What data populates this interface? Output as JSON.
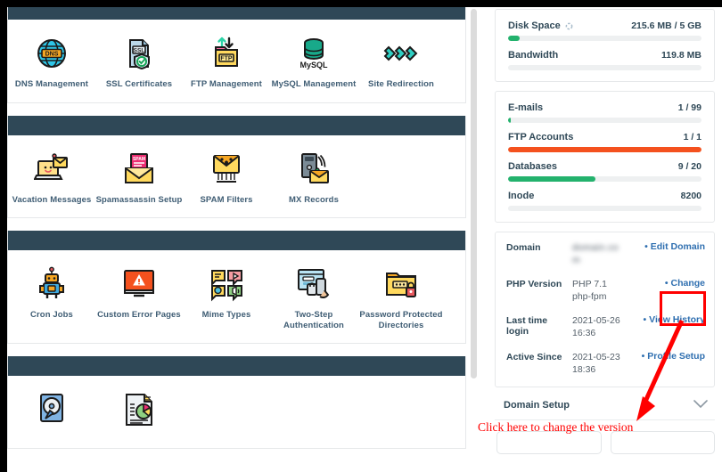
{
  "left_panel": {
    "groups": [
      {
        "group_name": "domains-group",
        "tiles": [
          {
            "icon": "dns-globe-icon",
            "label": "DNS Management"
          },
          {
            "icon": "ssl-certificate-icon",
            "label": "SSL Certificates"
          },
          {
            "icon": "ftp-folder-icon",
            "label": "FTP Management"
          },
          {
            "icon": "mysql-database-icon",
            "label": "MySQL Management"
          },
          {
            "icon": "site-redirection-icon",
            "label": "Site Redirection"
          }
        ]
      },
      {
        "group_name": "mail-group",
        "tiles": [
          {
            "icon": "vacation-message-icon",
            "label": "Vacation Messages"
          },
          {
            "icon": "spamassassin-icon",
            "label": "Spamassassin Setup"
          },
          {
            "icon": "spam-filter-icon",
            "label": "SPAM Filters"
          },
          {
            "icon": "mx-records-icon",
            "label": "MX Records"
          }
        ]
      },
      {
        "group_name": "advanced-group",
        "tiles": [
          {
            "icon": "cron-robot-icon",
            "label": "Cron Jobs"
          },
          {
            "icon": "custom-error-page-icon",
            "label": "Custom Error Pages"
          },
          {
            "icon": "mime-types-icon",
            "label": "Mime Types"
          },
          {
            "icon": "two-step-auth-icon",
            "label": "Two-Step Authentication"
          },
          {
            "icon": "password-protected-directories-icon",
            "label": "Password Protected Directories"
          }
        ]
      },
      {
        "group_name": "statistics-group",
        "tiles": [
          {
            "icon": "disk-backup-icon",
            "label": ""
          },
          {
            "icon": "report-chart-icon",
            "label": ""
          }
        ]
      }
    ]
  },
  "right_panel": {
    "usage_panel": {
      "stats": [
        {
          "name": "Disk Space",
          "value": "215.6 MB / 5 GB",
          "percent": 6,
          "color": "#23b26d",
          "has_refresh_icon": true
        },
        {
          "name": "Bandwidth",
          "value": "119.8 MB",
          "percent": 0,
          "color": "#23b26d",
          "has_refresh_icon": false
        }
      ]
    },
    "accounts_panel": {
      "stats": [
        {
          "name": "E-mails",
          "value": "1 / 99",
          "percent": 1,
          "color": "#23b26d",
          "has_refresh_icon": false
        },
        {
          "name": "FTP Accounts",
          "value": "1 / 1",
          "percent": 100,
          "color": "#f4511e",
          "has_refresh_icon": false
        },
        {
          "name": "Databases",
          "value": "9 / 20",
          "percent": 45,
          "color": "#23b26d",
          "has_refresh_icon": false
        },
        {
          "name": "Inode",
          "value": "8200",
          "percent": 0,
          "color": "#23b26d",
          "has_refresh_icon": false
        }
      ]
    },
    "info_panel": {
      "rows": [
        {
          "label": "Domain",
          "value": "domain.com",
          "blurred": true,
          "action": "Edit Domain"
        },
        {
          "label": "PHP Version",
          "value": "PHP 7.1 php-fpm",
          "blurred": false,
          "action": "Change"
        },
        {
          "label": "Last time login",
          "value": "2021-05-26 16:36",
          "blurred": false,
          "action": "View History"
        },
        {
          "label": "Active Since",
          "value": "2021-05-23 18:36",
          "blurred": false,
          "action": "Profile Setup"
        }
      ]
    },
    "accordion": {
      "label": "Domain Setup",
      "chevron": "chevron-down-icon"
    }
  },
  "annotation": {
    "text": "Click here to change the version",
    "color": "#ff0000",
    "highlight_target": "Change"
  }
}
